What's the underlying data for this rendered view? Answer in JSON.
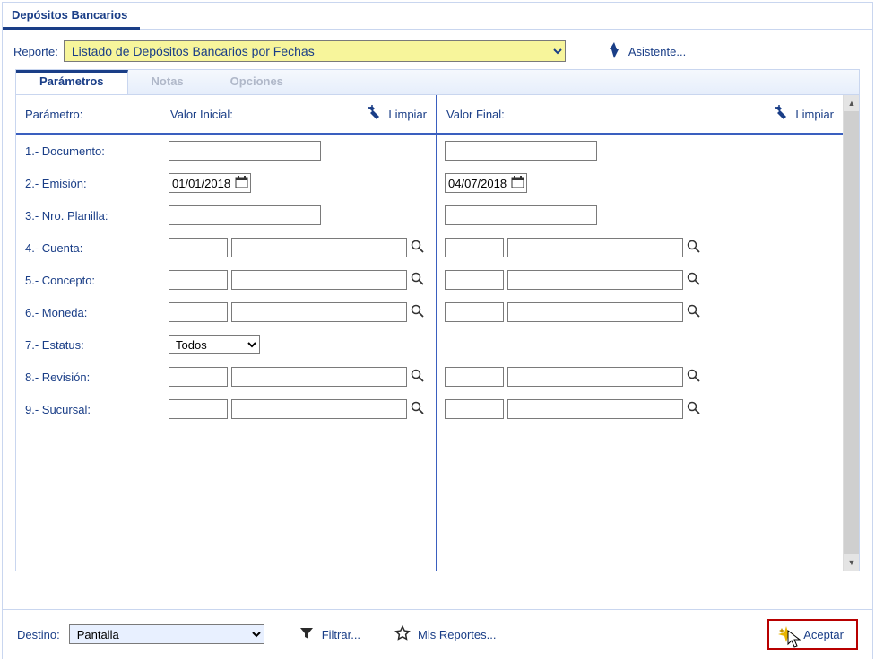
{
  "page_title": "Depósitos Bancarios",
  "report_label": "Reporte:",
  "report_selected": "Listado de Depósitos Bancarios por Fechas",
  "assistant_label": "Asistente...",
  "tabs": {
    "parametros": "Parámetros",
    "notas": "Notas",
    "opciones": "Opciones"
  },
  "headers": {
    "parametro": "Parámetro:",
    "valor_inicial": "Valor Inicial:",
    "valor_final": "Valor Final:",
    "limpiar": "Limpiar"
  },
  "params": {
    "p1": "1.- Documento:",
    "p2": "2.- Emisión:",
    "p3": "3.- Nro. Planilla:",
    "p4": "4.- Cuenta:",
    "p5": "5.- Concepto:",
    "p6": "6.- Moneda:",
    "p7": "7.- Estatus:",
    "p8": "8.- Revisión:",
    "p9": "9.- Sucursal:"
  },
  "values": {
    "emision_inicial": "01/01/2018",
    "emision_final": "04/07/2018",
    "estatus_selected": "Todos"
  },
  "footer": {
    "destino_label": "Destino:",
    "destino_selected": "Pantalla",
    "filtrar": "Filtrar...",
    "mis_reportes": "Mis Reportes...",
    "aceptar": "Aceptar"
  }
}
